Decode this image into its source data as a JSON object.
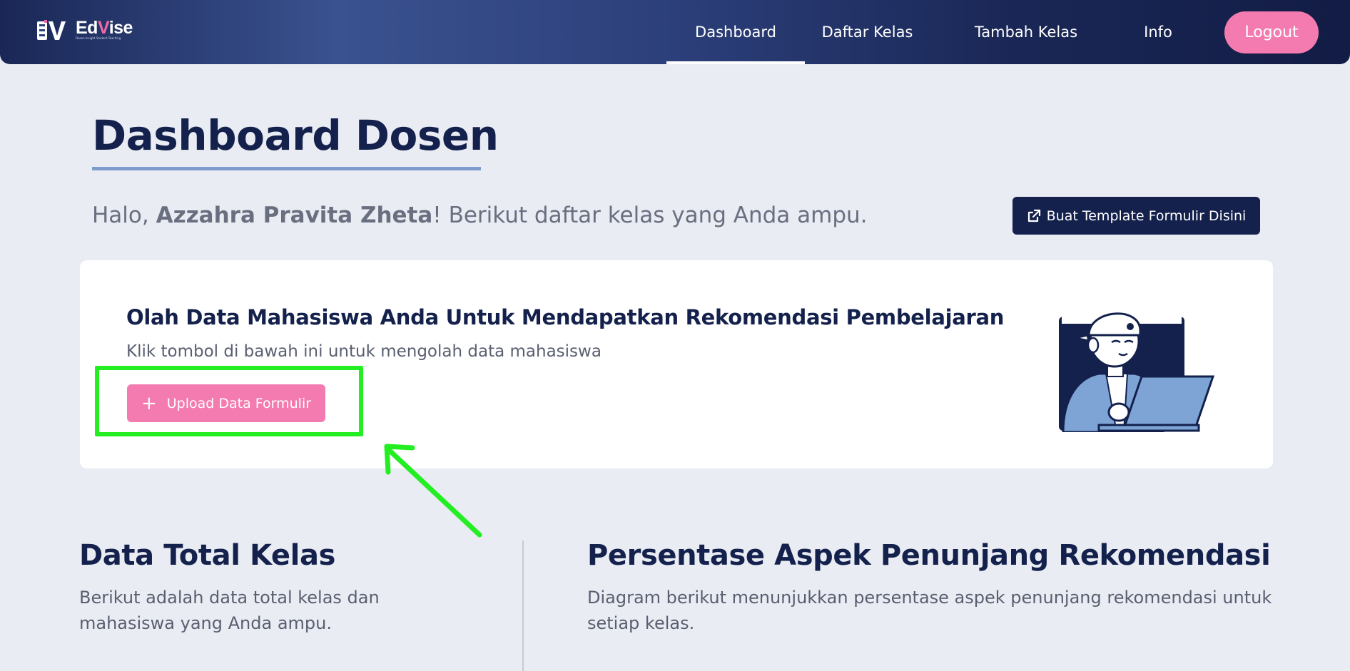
{
  "navbar": {
    "logo_text_main": "Ed",
    "logo_text_accent": "V",
    "logo_text_end": "ise",
    "logo_tagline": "Dosen Insight Student Teaching",
    "items": [
      {
        "label": "Dashboard",
        "active": true
      },
      {
        "label": "Daftar Kelas",
        "active": false
      },
      {
        "label": "Tambah Kelas",
        "active": false
      },
      {
        "label": "Info",
        "active": false
      }
    ],
    "logout_label": "Logout"
  },
  "header": {
    "title": "Dashboard Dosen",
    "greeting_prefix": "Halo, ",
    "user_name": "Azzahra Pravita Zheta",
    "greeting_suffix": "! Berikut daftar kelas yang Anda ampu.",
    "template_button_label": "Buat Template Formulir Disini",
    "template_button_icon": "external-link-icon"
  },
  "card": {
    "title": "Olah Data Mahasiswa Anda Untuk Mendapatkan Rekomendasi Pembelajaran",
    "subtitle": "Klik tombol di bawah ini untuk mengolah data mahasiswa",
    "upload_button_label": "Upload Data Formulir",
    "upload_button_icon": "plus-icon"
  },
  "sections": {
    "left": {
      "title": "Data Total Kelas",
      "description": "Berikut adalah data total kelas dan mahasiswa yang Anda ampu."
    },
    "right": {
      "title": "Persentase Aspek Penunjang Rekomendasi",
      "description": "Diagram berikut menunjukkan persentase aspek penunjang rekomendasi untuk setiap kelas."
    }
  },
  "colors": {
    "primary": "#14214c",
    "accent": "#f47bb0",
    "highlight": "#22ee22",
    "background": "#e9ecf3"
  }
}
